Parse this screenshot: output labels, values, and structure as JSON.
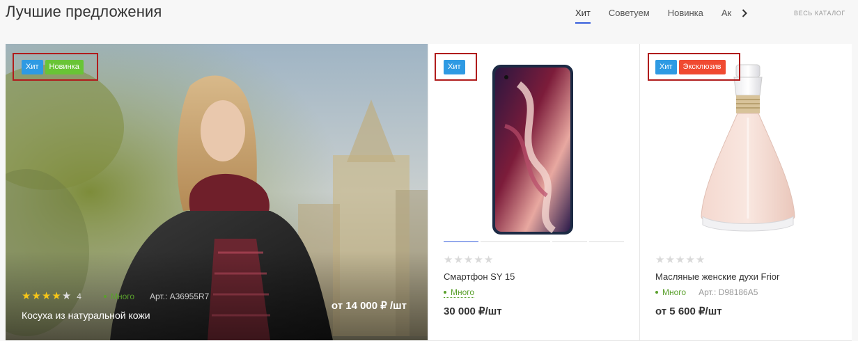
{
  "section": {
    "title": "Лучшие предложения",
    "tabs": [
      {
        "label": "Хит",
        "active": true
      },
      {
        "label": "Советуем",
        "active": false
      },
      {
        "label": "Новинка",
        "active": false
      },
      {
        "label": "Ак",
        "active": false
      }
    ],
    "catalog_link": "ВЕСЬ КАТАЛОГ"
  },
  "hero": {
    "badges": [
      "Хит",
      "Новинка"
    ],
    "rating": 4,
    "rating_count": "4",
    "stock": "Много",
    "article": "Арт.: A36955R7",
    "name": "Косуха из натуральной кожи",
    "price": "от 14 000 ₽ /шт"
  },
  "products": [
    {
      "badges": [
        "Хит"
      ],
      "name": "Смартфон SY 15",
      "stock": "Много",
      "article": "",
      "price": "30 000 ₽/шт",
      "rating": 0,
      "icon": "smartphone-image"
    },
    {
      "badges": [
        "Хит",
        "Эксклюзив"
      ],
      "name": "Масляные женские духи Frior",
      "stock": "Много",
      "article": "Арт.: D98186A5",
      "price": "от 5 600 ₽/шт",
      "rating": 0,
      "icon": "perfume-bottle-image"
    }
  ],
  "colors": {
    "accent": "#365edc",
    "badge_hit": "#2e9ae3",
    "badge_new": "#69c436",
    "badge_exclusive": "#f04a31",
    "stock_green": "#5aa02c",
    "highlight_box": "#b01c1c"
  }
}
